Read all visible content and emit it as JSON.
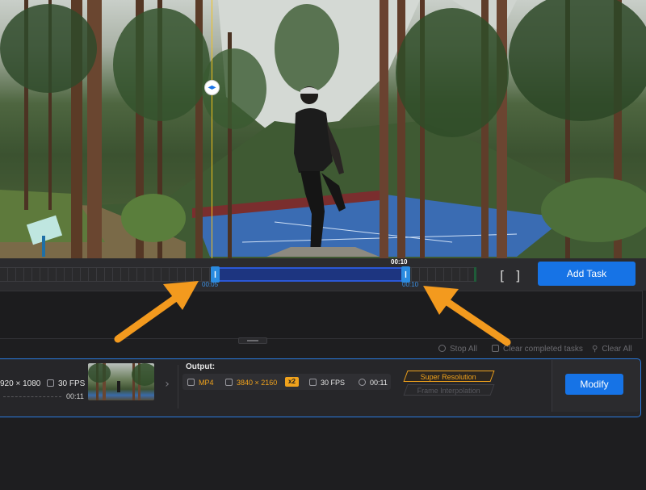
{
  "timeline": {
    "selection_end_marker": "00:10",
    "trim_start": "00:05",
    "trim_end": "00:10",
    "bracket_left": "[",
    "bracket_right": "]",
    "add_task_label": "Add Task"
  },
  "queue_controls": {
    "stop_all": "Stop All",
    "clear_completed": "Clear completed tasks",
    "clear_all": "Clear All"
  },
  "task": {
    "input": {
      "resolution": "920 × 1080",
      "fps": "30 FPS",
      "duration": "00:11"
    },
    "output": {
      "label": "Output:",
      "format": "MP4",
      "resolution": "3840 × 2160",
      "scale_badge": "x2",
      "fps": "30 FPS",
      "duration": "00:11"
    },
    "options": {
      "super_resolution": "Super Resolution",
      "frame_interpolation": "Frame Interpolation"
    },
    "modify_label": "Modify"
  },
  "icons": {
    "playhead": "split-arrows-icon",
    "stop": "stop-circle-icon",
    "clear_completed": "checkbox-icon",
    "clear_all": "broom-icon"
  },
  "colors": {
    "accent_blue": "#1673e6",
    "accent_orange": "#f0a21c",
    "annotation_arrow": "#f39a1e",
    "playhead": "#f3c21c"
  }
}
